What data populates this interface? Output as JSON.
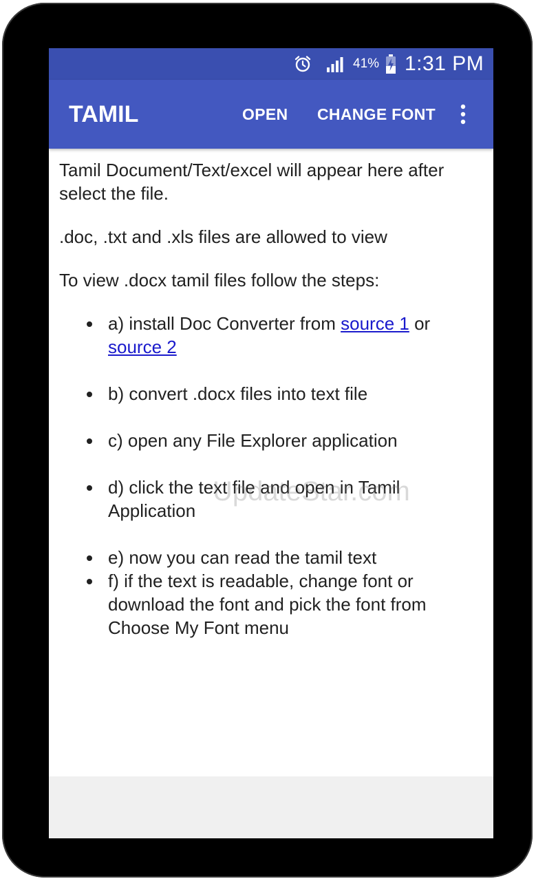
{
  "status_bar": {
    "alarm_icon": "alarm-clock-icon",
    "signal_icon": "cell-signal-icon",
    "battery_percent": "41%",
    "battery_icon": "battery-charging-icon",
    "time": "1:31 PM",
    "color": "#3a4fb0"
  },
  "app_bar": {
    "title": "TAMIL",
    "actions": {
      "open": "OPEN",
      "change_font": "CHANGE FONT"
    },
    "overflow_icon": "more-vert-icon",
    "color": "#4358c0"
  },
  "content": {
    "intro": "Tamil Document/Text/excel will appear here after select the file.",
    "allowed": ".doc, .txt and .xls files are allowed to view",
    "steps_heading": "To view .docx tamil files follow the steps:",
    "steps": {
      "a_prefix": "a) install Doc Converter from ",
      "a_link1": "source 1",
      "a_or": " or ",
      "a_link2": "source 2",
      "b": "b) convert .docx files into text file",
      "c": "c) open any File Explorer application",
      "d": "d) click the text file and open in Tamil Application",
      "e": "e) now you can read the tamil text",
      "f": "f) if the text is readable, change font or download the font and pick the font from Choose My Font menu"
    },
    "link_color": "#1a1acc"
  },
  "watermark": "UpdateStar.com"
}
